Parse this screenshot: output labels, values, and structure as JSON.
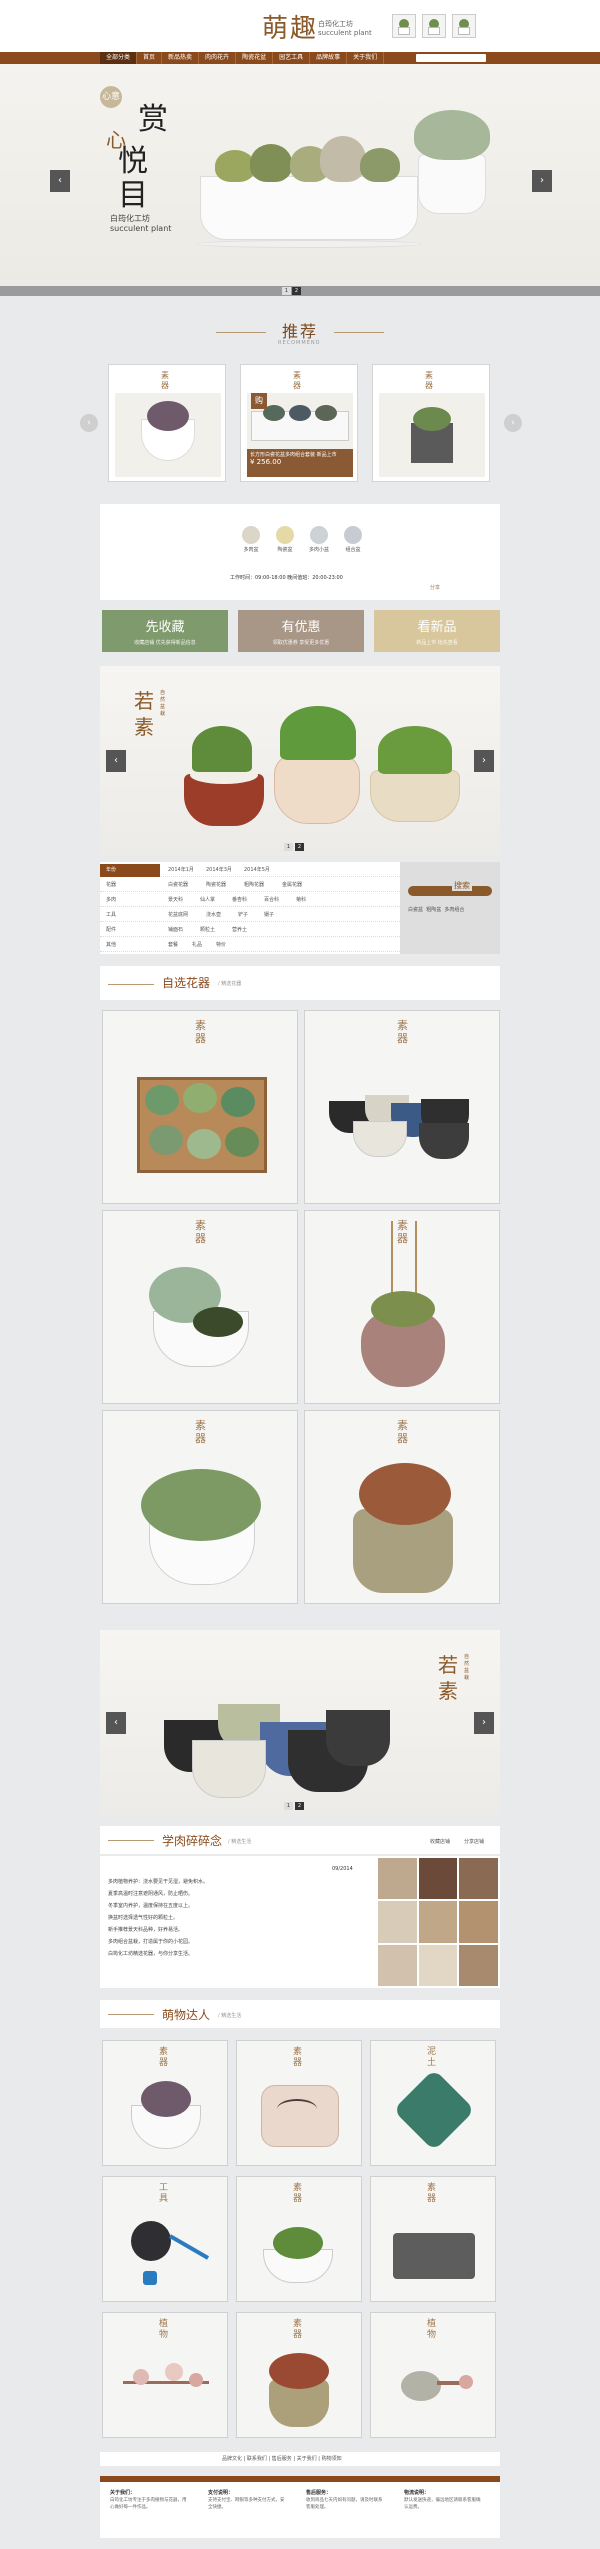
{
  "header": {
    "logo": "萌趣",
    "logo_sub_1": "白筠化工坊",
    "logo_sub_2": "succulent plant"
  },
  "nav": {
    "items": [
      "全部分类",
      "首页",
      "新品热卖",
      "肉肉花卉",
      "陶瓷花盆",
      "园艺工具",
      "品牌故事",
      "关于我们"
    ]
  },
  "banner": {
    "seal": "心意",
    "big_1": "赏",
    "big_2": "心",
    "big_3": "悦",
    "big_4": "目",
    "sub_1": "白筠化工坊",
    "sub_2": "succulent plant",
    "pages": [
      "1",
      "2"
    ]
  },
  "recommend": {
    "title": "推荐",
    "subtitle": "RECOMMEND",
    "cards": [
      {
        "label": "素器"
      },
      {
        "label": "素器",
        "badge": "购",
        "desc": "长方形白瓷花盆多肉组合套装 新品上市",
        "price": "¥ 256.00"
      },
      {
        "label": "素器"
      }
    ]
  },
  "categories": {
    "items": [
      "多肉盆",
      "陶瓷盆",
      "多肉小盆",
      "组合盆"
    ],
    "hours": "工作时间：09:00-18:00  晚间值班：20:00-23:00",
    "share": "分享"
  },
  "features": [
    {
      "title": "先收藏",
      "sub": "收藏店铺 优先获得新品信息",
      "color": "#7f9a6c"
    },
    {
      "title": "有优惠",
      "sub": "领取优惠券 享受更多优惠",
      "color": "#a89686"
    },
    {
      "title": "看新品",
      "sub": "新品上市 抢先查看",
      "color": "#d8c79c"
    }
  ],
  "banner2": {
    "title_1": "若",
    "title_2": "素",
    "small": "自然盆栽",
    "pages": [
      "1",
      "2"
    ]
  },
  "info_table": {
    "rows": [
      {
        "head": "年份",
        "cells": [
          "2014年1月",
          "2014年3月",
          "2014年5月"
        ]
      },
      {
        "head": "花器",
        "cells": [
          "白瓷花器",
          "陶瓷花器",
          "粗陶花器",
          "金属花器"
        ]
      },
      {
        "head": "多肉",
        "cells": [
          "景天科",
          "仙人掌",
          "番杏科",
          "百合科",
          "菊科"
        ]
      },
      {
        "head": "工具",
        "cells": [
          "花盆底网",
          "浇水壶",
          "铲子",
          "镊子"
        ]
      },
      {
        "head": "配件",
        "cells": [
          "铺面石",
          "颗粒土",
          "营养土"
        ]
      },
      {
        "head": "其他",
        "cells": [
          "套餐",
          "礼品",
          "特价"
        ]
      }
    ]
  },
  "search": {
    "label": "搜索",
    "tags": [
      "白瓷盆",
      "粗陶盆",
      "多肉组合"
    ]
  },
  "section_flowers": {
    "title": "自选花器",
    "sub": "/ 精选花器",
    "cards": [
      "素器",
      "素器",
      "素器",
      "素器",
      "素器",
      "素器"
    ]
  },
  "banner3": {
    "title_1": "若",
    "title_2": "素",
    "small": "自然盆栽",
    "pages": [
      "1",
      "2"
    ]
  },
  "section_news": {
    "title": "学肉碎碎念",
    "sub": "/ 精选生活",
    "right_1": "收藏店铺",
    "right_2": "分享店铺",
    "date": "09/2014",
    "lines": [
      "多肉植物养护：浇水要见干见湿，避免积水。",
      "夏季高温时注意遮阴通风，防止晒伤。",
      "冬季室内养护，温度保持在五度以上。",
      "换盆时选择透气性好的颗粒土。",
      "新手推荐景天科品种，好养易活。",
      "多肉组合盆栽，打造属于你的小花园。",
      "白筠化工坊精选花器，与你分享生活。"
    ]
  },
  "section_talent": {
    "title": "萌物达人",
    "sub": "/ 精选生活",
    "cards": [
      "素器",
      "素器",
      "泥土",
      "工具",
      "素器",
      "素器",
      "植物",
      "素器",
      "植物"
    ]
  },
  "footer": {
    "links": [
      "品牌文化",
      "联系我们",
      "售后服务",
      "关于我们",
      "购物须知"
    ],
    "cols": [
      {
        "h": "关于我们：",
        "t": "白筠化工坊专注于多肉植物与花器，用心做好每一件作品。"
      },
      {
        "h": "支付说明：",
        "t": "支持支付宝、网银等多种支付方式，安全快捷。"
      },
      {
        "h": "售后服务：",
        "t": "收到商品七天内如有问题，请及时联系客服处理。"
      },
      {
        "h": "物流说明：",
        "t": "默认发送快递，偏远地区请联系客服确认运费。"
      }
    ]
  }
}
